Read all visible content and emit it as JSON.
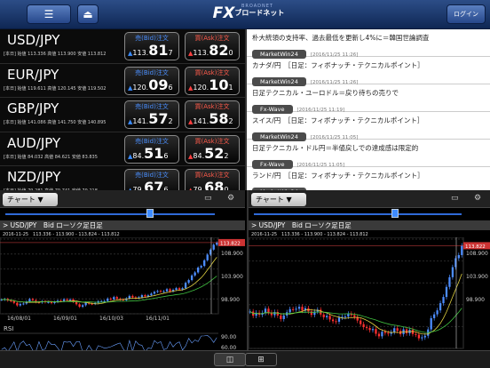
{
  "header": {
    "logo": "FX",
    "logo_net": "ブロードネット",
    "logo_sub": "BROADNET",
    "login_label": "ログイン",
    "menu_icon": "hamburger-icon",
    "eject_icon": "eject-icon"
  },
  "colors": {
    "bid": "#3a8cff",
    "ask": "#ff4040",
    "header": "#1d3a70",
    "candle_up": "#4c8dff",
    "candle_down": "#ff3030"
  },
  "rates": [
    {
      "pair": "USD/JPY",
      "info": "[本日] 始値 113.336 高値 113.900 安値 113.812",
      "bid_label": "売(Bid)注文",
      "ask_label": "買(Ask)注文",
      "bid": {
        "a": "113.",
        "b": "81",
        "c": "7"
      },
      "ask": {
        "a": "113.",
        "b": "82",
        "c": "0"
      }
    },
    {
      "pair": "EUR/JPY",
      "info": "[本日] 始値 119.611 高値 120.145 安値 119.502",
      "bid_label": "売(Bid)注文",
      "ask_label": "買(Ask)注文",
      "bid": {
        "a": "120.",
        "b": "09",
        "c": "6"
      },
      "ask": {
        "a": "120.",
        "b": "10",
        "c": "1"
      }
    },
    {
      "pair": "GBP/JPY",
      "info": "[本日] 始値 141.086 高値 141.750 安値 140.895",
      "bid_label": "売(Bid)注文",
      "ask_label": "買(Ask)注文",
      "bid": {
        "a": "141.",
        "b": "57",
        "c": "2"
      },
      "ask": {
        "a": "141.",
        "b": "58",
        "c": "2"
      }
    },
    {
      "pair": "AUD/JPY",
      "info": "[本日] 始値 84.032 高値 84.621 安値 83.835",
      "bid_label": "売(Bid)注文",
      "ask_label": "買(Ask)注文",
      "bid": {
        "a": "84.",
        "b": "51",
        "c": "6"
      },
      "ask": {
        "a": "84.",
        "b": "52",
        "c": "2"
      }
    },
    {
      "pair": "NZD/JPY",
      "info": "[本日] 始値 79.281 高値 79.741 安値 79.218",
      "bid_label": "売(Bid)注文",
      "ask_label": "買(Ask)注文",
      "bid": {
        "a": "79.",
        "b": "67",
        "c": "6"
      },
      "ask": {
        "a": "79.",
        "b": "68",
        "c": "0"
      }
    }
  ],
  "news": [
    {
      "title": "朴大統領の支持率、過去最低を更新し4%に＝韓国世論調査",
      "tag": "MarketWin24",
      "date": "[2016/11/25 11:26]"
    },
    {
      "title": "カナダ/円　［日足：フィボナッチ・テクニカルポイント］",
      "tag": "MarketWin24",
      "date": "[2016/11/25 11:26]"
    },
    {
      "title": "日足テクニカル・ユーロドル＝戻り待ちの売りで",
      "tag": "Fx-Wave",
      "date": "[2016/11/25 11:19]"
    },
    {
      "title": "スイス/円　［日足：フィボナッチ・テクニカルポイント］",
      "tag": "MarketWin24",
      "date": "[2016/11/25 11:05]"
    },
    {
      "title": "日足テクニカル・ドル円＝半値戻しでの達成感は限定的",
      "tag": "Fx-Wave",
      "date": "[2016/11/25 11:05]"
    },
    {
      "title": "ランド/円　［日足：フィボナッチ・テクニカルポイント］",
      "tag": "MarketWin24",
      "date": "[2016/11/25 11:05]"
    }
  ],
  "charts": [
    {
      "dropdown": "チャート ▼",
      "title": "> USD/JPY　Bid ローソク足日足",
      "info": "2016-11-25　113.336 - 113.900 - 113.824 - 113.812",
      "last": "113.822",
      "yticks": [
        "108.900",
        "103.900",
        "98.900"
      ],
      "xticks": [
        "16/08/01",
        "16/09/01",
        "16/10/03",
        "16/11/01"
      ],
      "rsi_label": "RSI",
      "rsi_ticks": [
        "90.00",
        "60.00"
      ]
    },
    {
      "dropdown": "チャート ▼",
      "title": "> USD/JPY　Bid ローソク足日足",
      "info": "2016-11-25　113.336 - 113.900 - 113.824 - 113.812",
      "last": "113.822",
      "yticks": [
        "108.900",
        "103.900",
        "98.900"
      ]
    }
  ],
  "footer": {
    "split_icon": "split-view-icon",
    "grid_icon": "grid-view-icon"
  }
}
